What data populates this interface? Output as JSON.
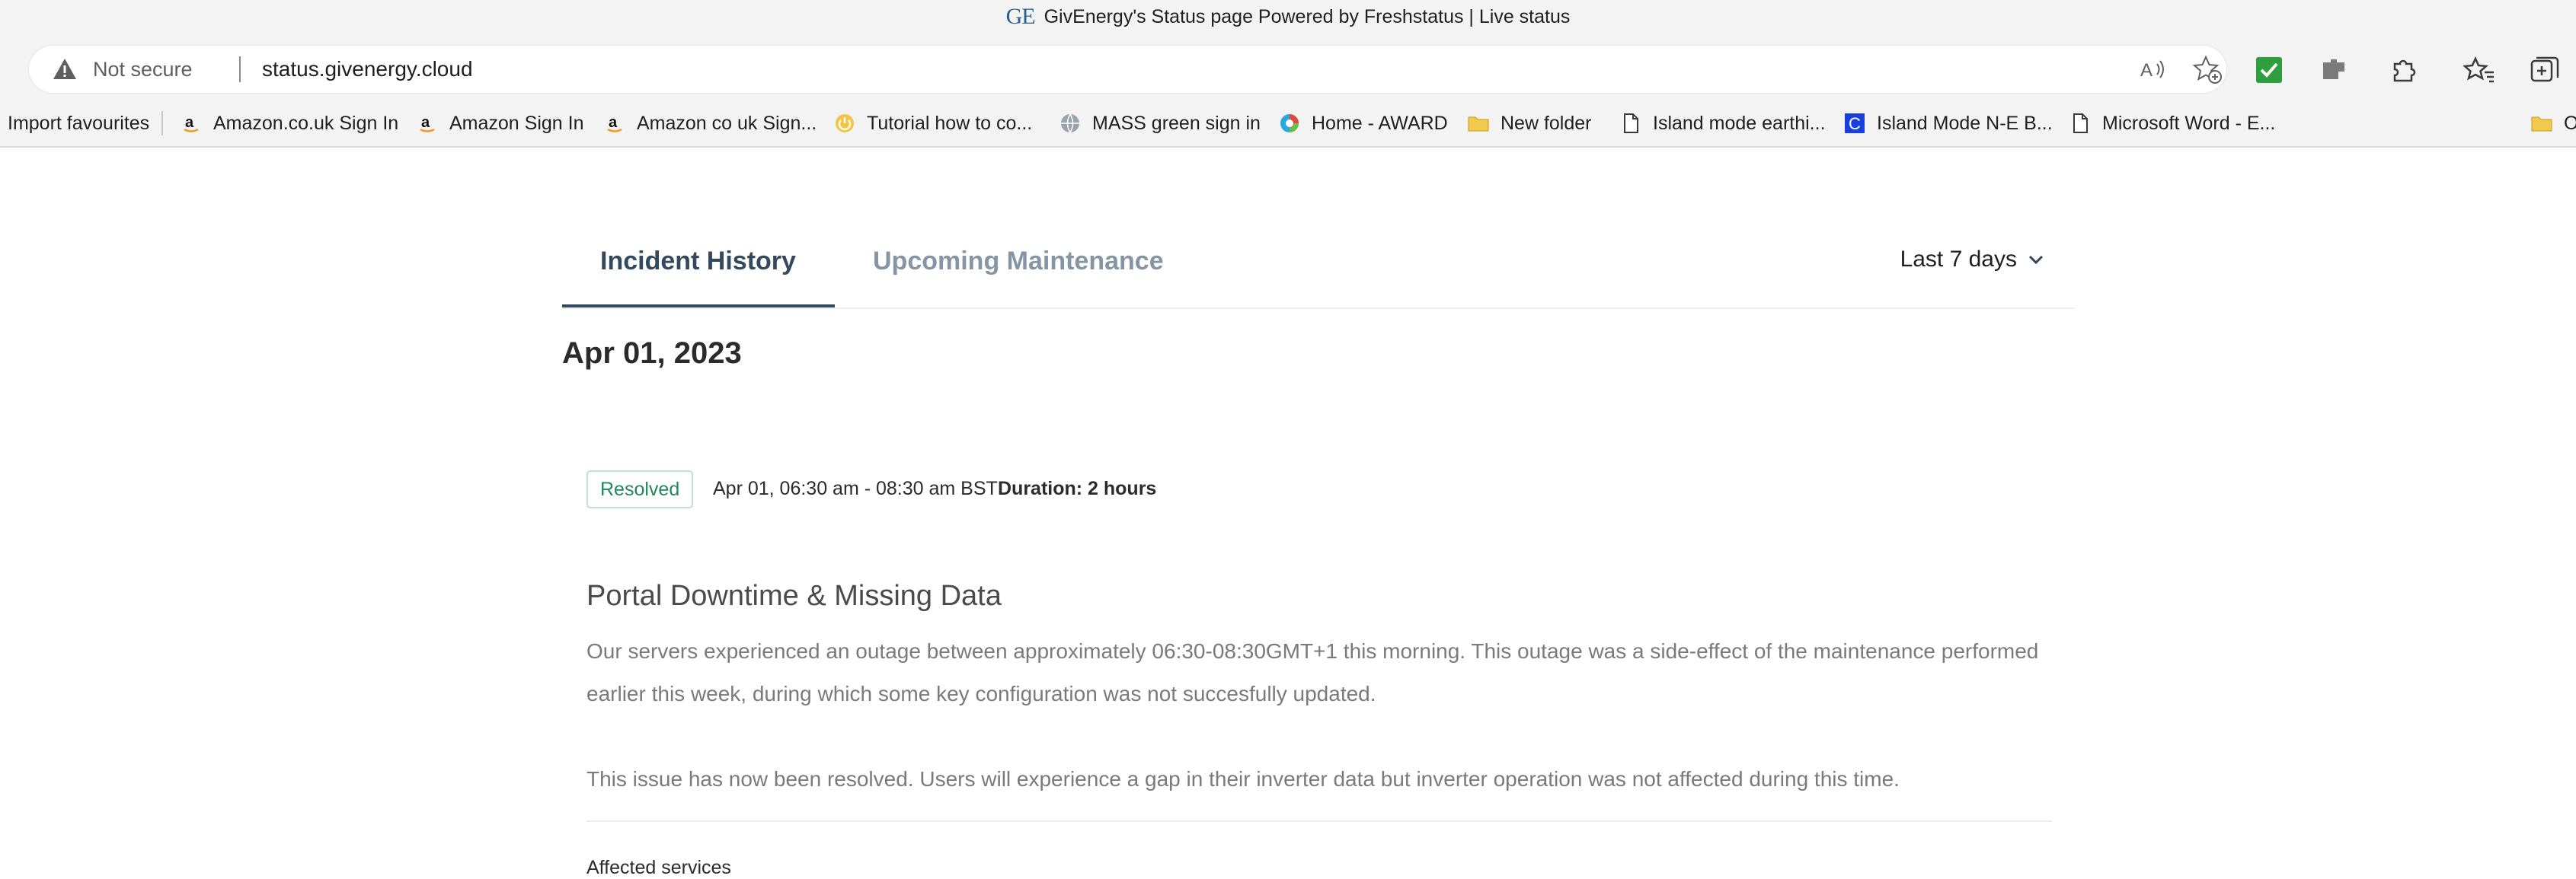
{
  "browser": {
    "window_title": "GivEnergy's Status page Powered by Freshstatus | Live status",
    "logo_text": "GE",
    "security_label": "Not secure",
    "url": "status.givenergy.cloud",
    "icons": {
      "security": "warning-triangle-icon",
      "read_aloud": "read-aloud-icon",
      "add_favorite": "add-favorite-icon",
      "extension_check": "check-extension-icon",
      "extension_gray": "puzzle-extension-icon",
      "extensions": "extensions-icon",
      "favorites": "favorites-icon",
      "collections": "collections-icon"
    }
  },
  "bookmarks": [
    {
      "label": "Import favourites",
      "icon": ""
    },
    {
      "label": "Amazon.co.uk Sign In",
      "icon": "amazon-icon"
    },
    {
      "label": "Amazon Sign In",
      "icon": "amazon-icon"
    },
    {
      "label": "Amazon co uk Sign...",
      "icon": "amazon-icon"
    },
    {
      "label": "Tutorial  how to co...",
      "icon": "power-icon"
    },
    {
      "label": "MASS green sign in",
      "icon": "globe-icon"
    },
    {
      "label": "Home - AWARD",
      "icon": "edge-icon"
    },
    {
      "label": "New folder",
      "icon": "folder-icon"
    },
    {
      "label": "Island mode earthi...",
      "icon": "page-icon"
    },
    {
      "label": "Island Mode N-E B...",
      "icon": "c-icon"
    },
    {
      "label": "Microsoft Word - E...",
      "icon": "page-icon"
    },
    {
      "label": "O",
      "icon": "folder-icon"
    }
  ],
  "tabs": {
    "incident_history": "Incident History",
    "upcoming_maintenance": "Upcoming Maintenance"
  },
  "range_filter": {
    "selected": "Last 7 days"
  },
  "date_heading": "Apr 01, 2023",
  "incident": {
    "status": "Resolved",
    "time_range": "Apr 01, 06:30 am - 08:30 am BST",
    "duration": "Duration: 2 hours",
    "title": "Portal Downtime & Missing Data",
    "paragraph_1": "Our servers experienced an outage between approximately 06:30-08:30GMT+1 this morning. This outage was a side-effect of the maintenance performed earlier this week, during which some key configuration was not succesfully updated.",
    "paragraph_2": "This issue has now been resolved. Users will experience a gap in their inverter data but inverter operation was not affected during this time.",
    "affected_services_label": "Affected services"
  },
  "colors": {
    "tab_active": "#34495e",
    "tab_inactive": "#8595a4",
    "resolved_text": "#1e8a5a",
    "resolved_border": "#bfe3cf",
    "body_text": "#7a7a7a"
  }
}
